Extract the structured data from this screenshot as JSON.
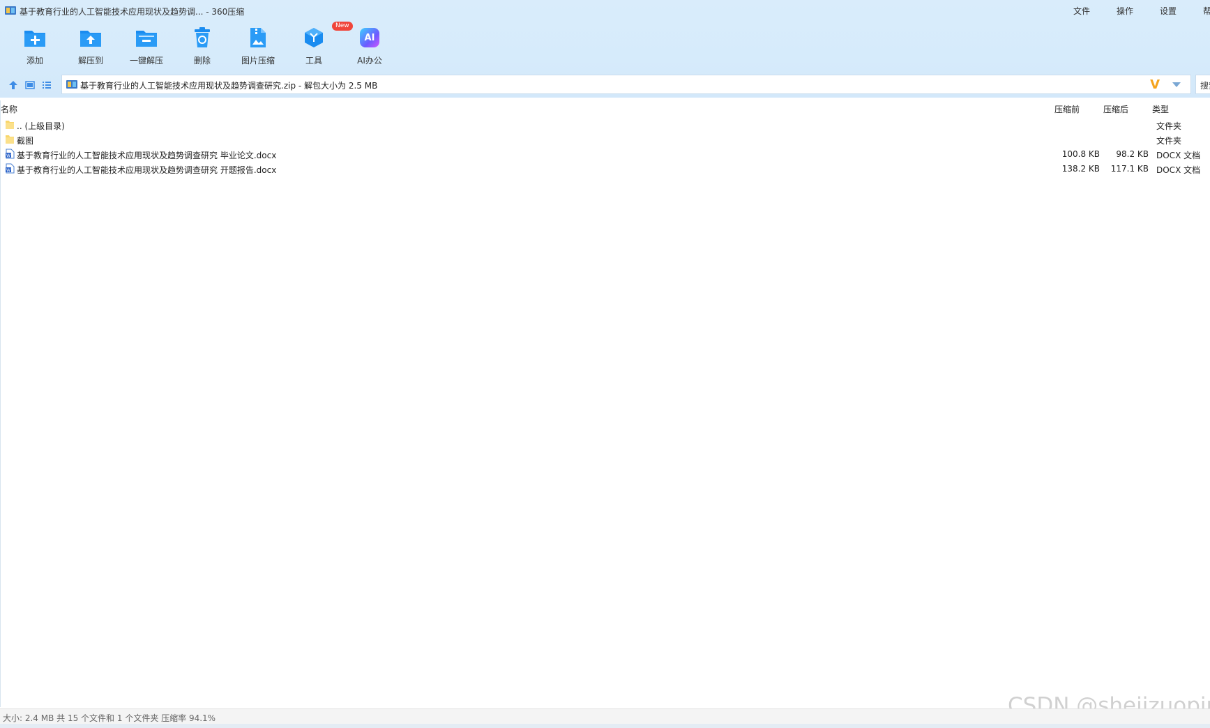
{
  "window": {
    "title": "基于教育行业的人工智能技术应用现状及趋势调... - 360压缩",
    "menu": [
      "文件",
      "操作",
      "设置",
      "帮"
    ]
  },
  "toolbar": {
    "items": [
      {
        "label": "添加",
        "icon": "add-folder-icon"
      },
      {
        "label": "解压到",
        "icon": "extract-to-icon"
      },
      {
        "label": "一键解压",
        "icon": "one-click-extract-icon"
      },
      {
        "label": "删除",
        "icon": "recycle-bin-icon"
      },
      {
        "label": "图片压缩",
        "icon": "image-compress-icon"
      },
      {
        "label": "工具",
        "icon": "tools-cube-icon",
        "badge": "New"
      },
      {
        "label": "AI办公",
        "icon": "ai-office-icon",
        "icon_text": "AI"
      }
    ]
  },
  "addressbar": {
    "path": "基于教育行业的人工智能技术应用现状及趋势调查研究.zip - 解包大小为 2.5 MB",
    "vip_mark": "V",
    "search_placeholder": "搜索"
  },
  "list": {
    "columns": {
      "name": "名称",
      "before": "压缩前",
      "after": "压缩后",
      "type": "类型"
    },
    "rows": [
      {
        "icon": "folder-icon",
        "name": ".. (上级目录)",
        "before": "",
        "after": "",
        "type": "文件夹"
      },
      {
        "icon": "folder-icon",
        "name": "截图",
        "before": "",
        "after": "",
        "type": "文件夹"
      },
      {
        "icon": "word-doc-icon",
        "name": "基于教育行业的人工智能技术应用现状及趋势调查研究 毕业论文.docx",
        "before": "100.8 KB",
        "after": "98.2 KB",
        "type": "DOCX 文档"
      },
      {
        "icon": "word-doc-icon",
        "name": "基于教育行业的人工智能技术应用现状及趋势调查研究 开题报告.docx",
        "before": "138.2 KB",
        "after": "117.1 KB",
        "type": "DOCX 文档"
      }
    ]
  },
  "statusbar": {
    "text": "大小: 2.4 MB 共 15 个文件和 1 个文件夹 压缩率 94.1%"
  },
  "watermark": "CSDN @shejizuopin",
  "colors": {
    "chrome_bg": "#d6ebfb",
    "icon_blue": "#1a8cf0",
    "badge_red": "#f0453a",
    "vip_orange": "#f5a41e",
    "folder_yellow": "#f8d66b"
  }
}
